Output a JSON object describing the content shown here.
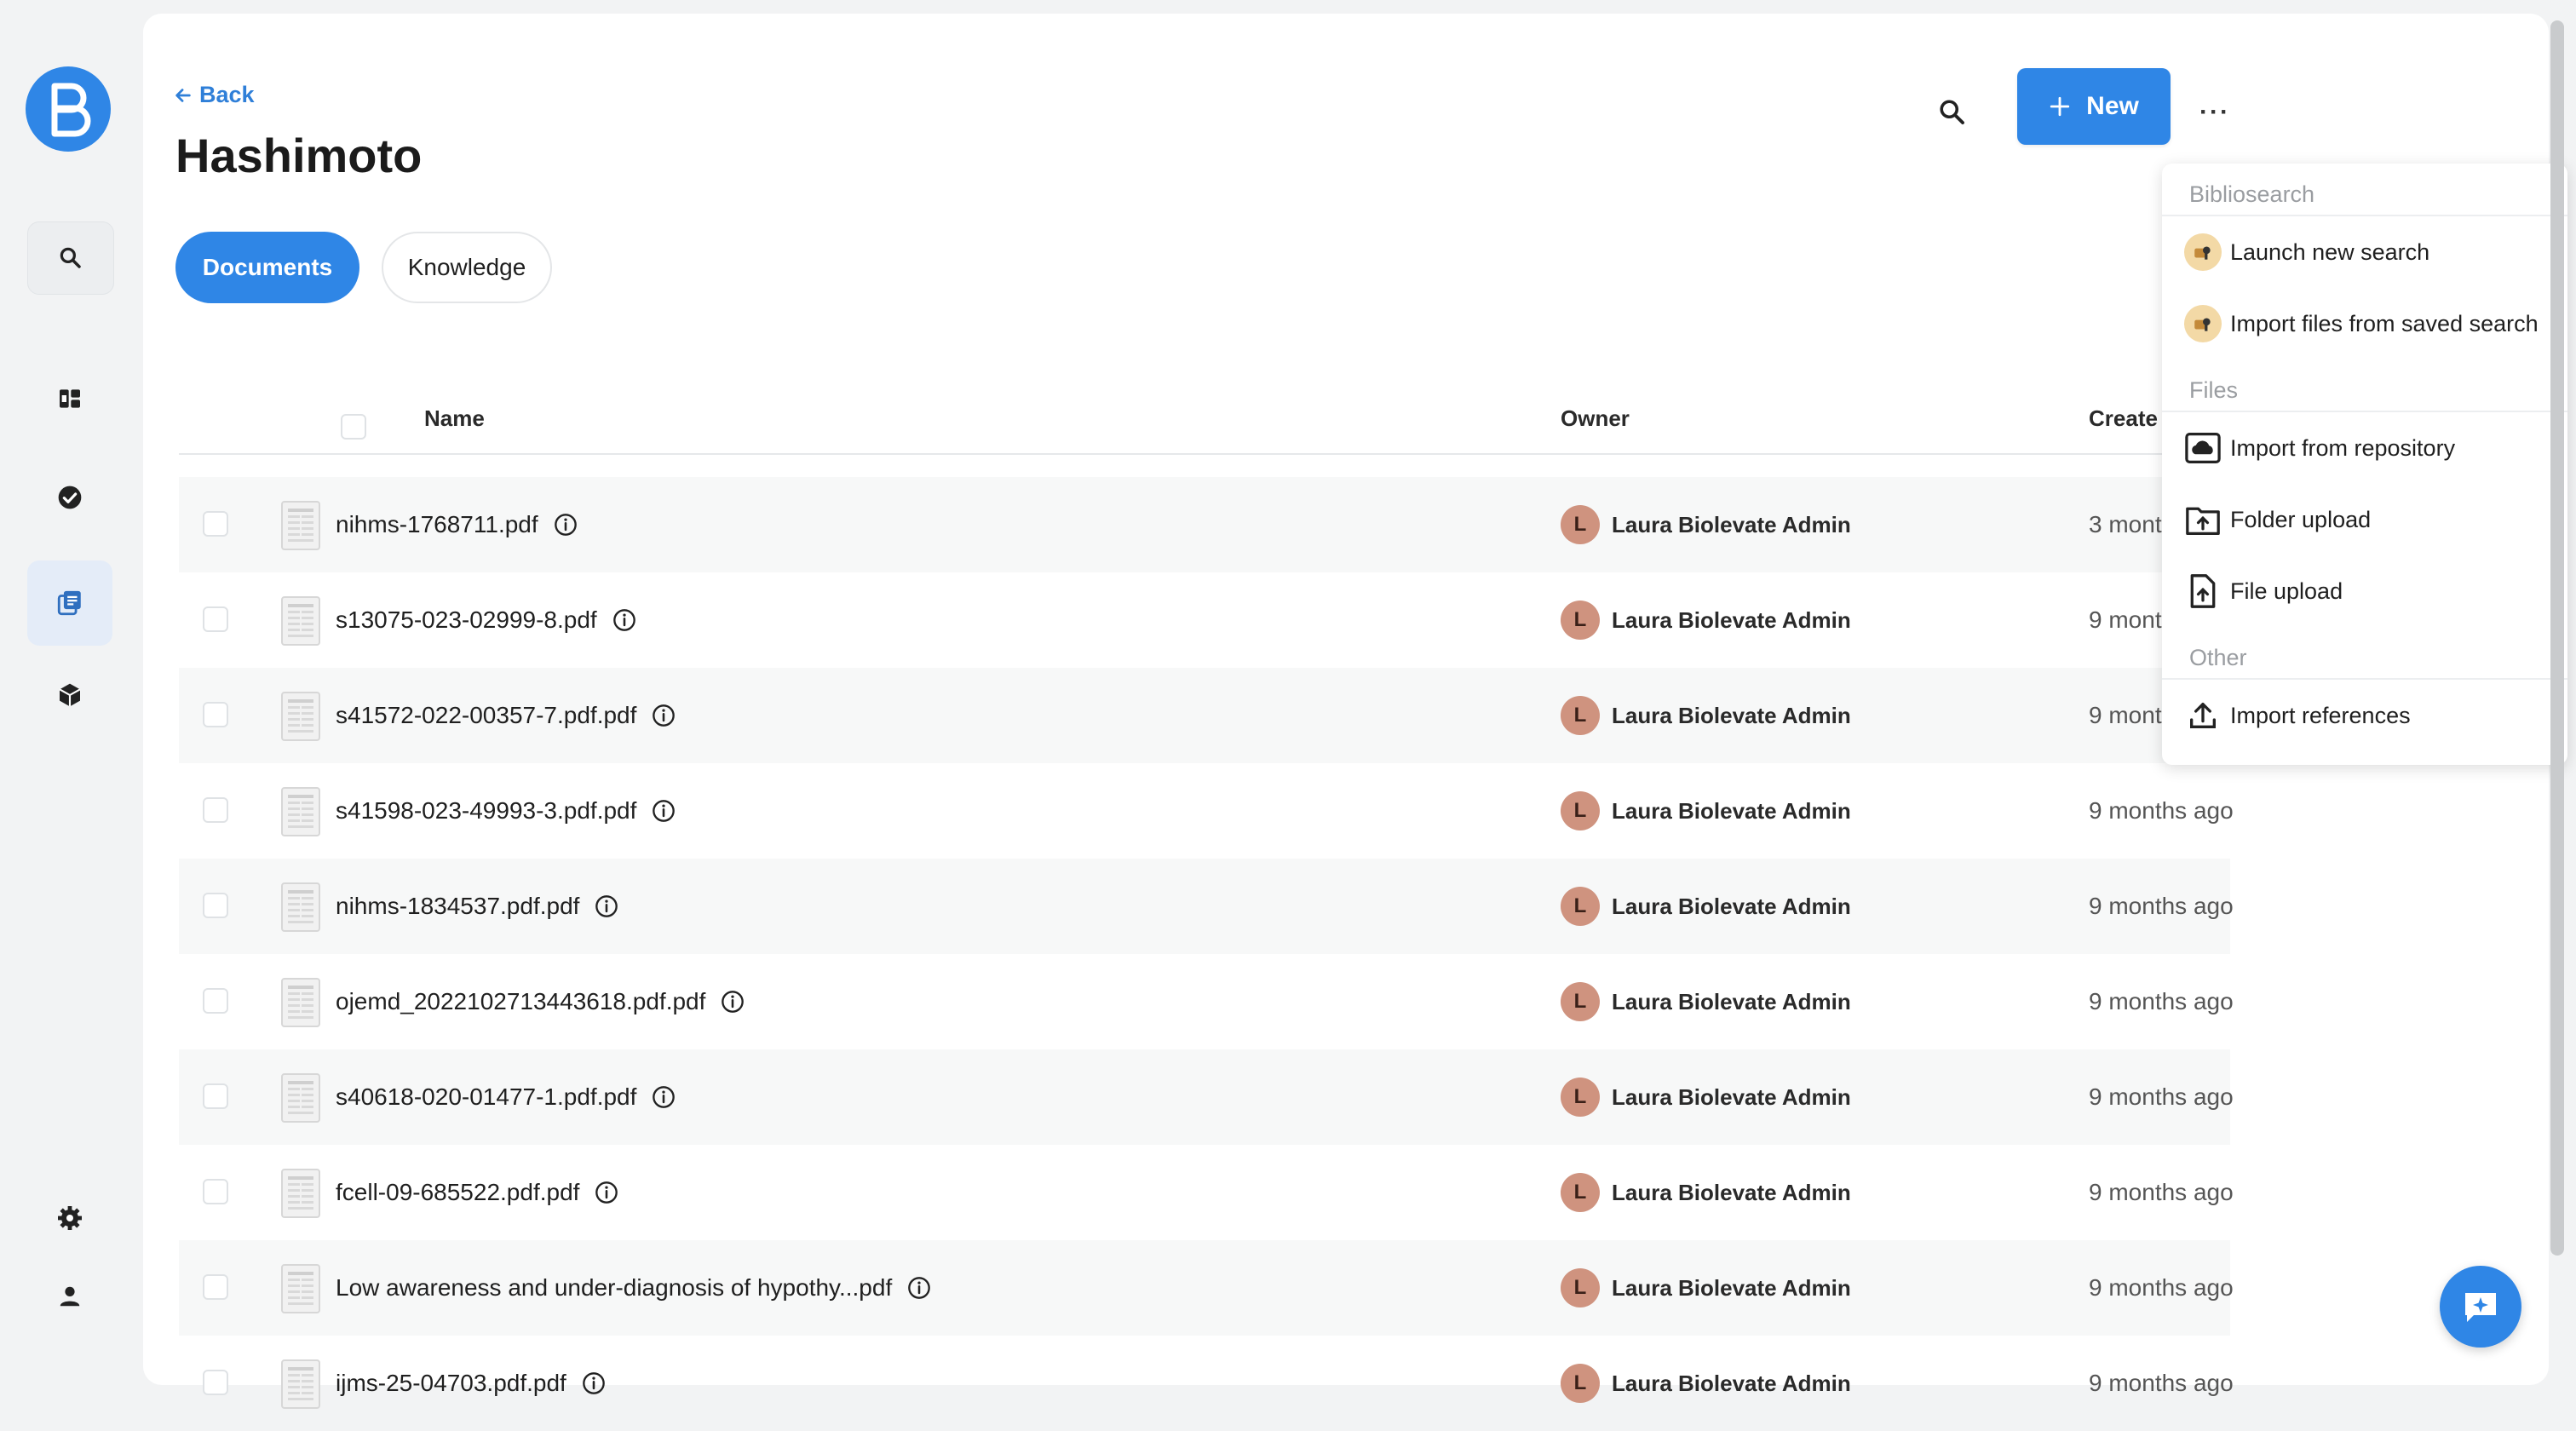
{
  "nav": {
    "back_label": "Back",
    "page_title": "Hashimoto"
  },
  "tabs": [
    {
      "label": "Documents",
      "active": true
    },
    {
      "label": "Knowledge",
      "active": false
    }
  ],
  "toolbar": {
    "new_label": "New",
    "more_label": "···"
  },
  "table": {
    "columns": {
      "name": "Name",
      "owner": "Owner",
      "created": "Create"
    },
    "rows": [
      {
        "name": "nihms-1768711.pdf",
        "owner_initial": "L",
        "owner": "Laura Biolevate Admin",
        "created": "3 mont"
      },
      {
        "name": "s13075-023-02999-8.pdf",
        "owner_initial": "L",
        "owner": "Laura Biolevate Admin",
        "created": "9 mont"
      },
      {
        "name": "s41572-022-00357-7.pdf.pdf",
        "owner_initial": "L",
        "owner": "Laura Biolevate Admin",
        "created": "9 mont"
      },
      {
        "name": "s41598-023-49993-3.pdf.pdf",
        "owner_initial": "L",
        "owner": "Laura Biolevate Admin",
        "created": "9 months ago"
      },
      {
        "name": "nihms-1834537.pdf.pdf",
        "owner_initial": "L",
        "owner": "Laura Biolevate Admin",
        "created": "9 months ago"
      },
      {
        "name": "ojemd_2022102713443618.pdf.pdf",
        "owner_initial": "L",
        "owner": "Laura Biolevate Admin",
        "created": "9 months ago"
      },
      {
        "name": "s40618-020-01477-1.pdf.pdf",
        "owner_initial": "L",
        "owner": "Laura Biolevate Admin",
        "created": "9 months ago"
      },
      {
        "name": "fcell-09-685522.pdf.pdf",
        "owner_initial": "L",
        "owner": "Laura Biolevate Admin",
        "created": "9 months ago"
      },
      {
        "name": "Low awareness and under-diagnosis of hypothy...pdf",
        "owner_initial": "L",
        "owner": "Laura Biolevate Admin",
        "created": "9 months ago"
      },
      {
        "name": "ijms-25-04703.pdf.pdf",
        "owner_initial": "L",
        "owner": "Laura Biolevate Admin",
        "created": "9 months ago"
      }
    ]
  },
  "dropdown": {
    "sections": [
      {
        "title": "Bibliosearch",
        "items": [
          {
            "label": "Launch new search",
            "icon": "bibliosearch-icon"
          },
          {
            "label": "Import files from saved search",
            "icon": "bibliosearch-icon"
          }
        ]
      },
      {
        "title": "Files",
        "items": [
          {
            "label": "Import from repository",
            "icon": "cloud-icon"
          },
          {
            "label": "Folder upload",
            "icon": "folder-upload-icon"
          },
          {
            "label": "File upload",
            "icon": "file-upload-icon"
          }
        ]
      },
      {
        "title": "Other",
        "items": [
          {
            "label": "Import references",
            "icon": "upload-icon"
          }
        ]
      }
    ]
  },
  "colors": {
    "accent": "#2f86e6",
    "avatar": "#cf937f",
    "back_link": "#2f7fd8"
  }
}
